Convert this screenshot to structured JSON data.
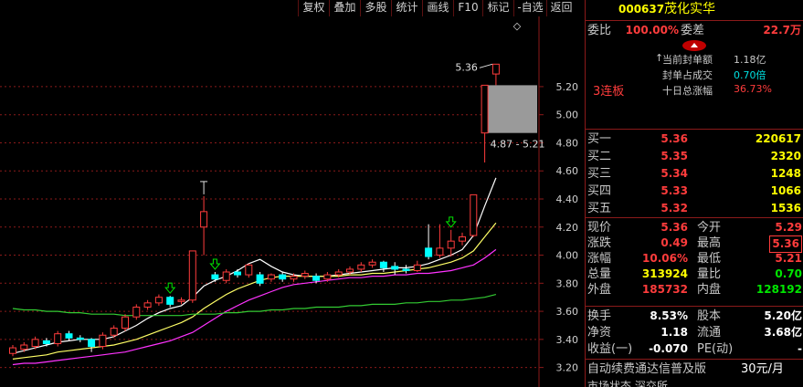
{
  "toolbar": {
    "buttons": [
      "复权",
      "叠加",
      "多股",
      "统计",
      "画线",
      "F10",
      "标记",
      "-自选",
      "返回"
    ]
  },
  "stock": {
    "code": "000637",
    "name": "茂化实华",
    "weibi_label": "委比",
    "weibi_value": "100.00%",
    "weicha_label": "委差",
    "weicha_value": "22.7万",
    "streak": "3连板",
    "seal_amount_label": "当前封单额",
    "seal_amount_value": "1.18亿",
    "seal_ratio_label": "封单占成交",
    "seal_ratio_value": "0.70倍",
    "tenday_label": "十日总涨幅",
    "tenday_value": "36.73%"
  },
  "bids": [
    {
      "label": "买一",
      "price": "5.36",
      "volume": "220617"
    },
    {
      "label": "买二",
      "price": "5.35",
      "volume": "2320"
    },
    {
      "label": "买三",
      "price": "5.34",
      "volume": "1248"
    },
    {
      "label": "买四",
      "price": "5.33",
      "volume": "1066"
    },
    {
      "label": "买五",
      "price": "5.32",
      "volume": "1536"
    }
  ],
  "quote": [
    {
      "l1": "现价",
      "v1": "5.36",
      "c1": "red",
      "l2": "今开",
      "v2": "5.29",
      "c2": "red",
      "box2": false
    },
    {
      "l1": "涨跌",
      "v1": "0.49",
      "c1": "red",
      "l2": "最高",
      "v2": "5.36",
      "c2": "red",
      "box2": true
    },
    {
      "l1": "涨幅",
      "v1": "10.06%",
      "c1": "red",
      "l2": "最低",
      "v2": "5.21",
      "c2": "red",
      "box2": false
    },
    {
      "l1": "总量",
      "v1": "313924",
      "c1": "yellow",
      "l2": "量比",
      "v2": "0.70",
      "c2": "green",
      "box2": false
    },
    {
      "l1": "外盘",
      "v1": "185732",
      "c1": "red",
      "l2": "内盘",
      "v2": "128192",
      "c2": "green",
      "box2": false
    }
  ],
  "fundamentals": [
    {
      "l1": "换手",
      "v1": "8.53%",
      "l2": "股本",
      "v2": "5.20亿"
    },
    {
      "l1": "净资",
      "v1": "1.18",
      "l2": "流通",
      "v2": "3.68亿"
    },
    {
      "l1": "收益(一)",
      "v1": "-0.070",
      "l2": "PE(动)",
      "v2": "-"
    }
  ],
  "footer": {
    "ad_text": "自动续费通达信普及版",
    "price_text": "30元/月",
    "cut_text": "市场状态 深交所 ..."
  },
  "chart_data": {
    "type": "candlestick",
    "y_axis": {
      "min": 3.1,
      "max": 5.7,
      "ticks": [
        "5.20",
        "5.00",
        "4.80",
        "4.60",
        "4.40",
        "4.20",
        "4.00",
        "3.80",
        "3.60",
        "3.40",
        "3.20"
      ]
    },
    "annotations": {
      "high_label": "5.36",
      "range_label": "4.87 - 5.21",
      "diamond_symbol": "◇"
    },
    "candles": [
      {
        "o": 3.3,
        "c": 3.34,
        "h": 3.36,
        "l": 3.28
      },
      {
        "o": 3.33,
        "c": 3.36,
        "h": 3.38,
        "l": 3.31
      },
      {
        "o": 3.35,
        "c": 3.4,
        "h": 3.42,
        "l": 3.33
      },
      {
        "o": 3.39,
        "c": 3.37,
        "h": 3.41,
        "l": 3.35
      },
      {
        "o": 3.37,
        "c": 3.44,
        "h": 3.46,
        "l": 3.35
      },
      {
        "o": 3.44,
        "c": 3.41,
        "h": 3.46,
        "l": 3.39
      },
      {
        "o": 3.41,
        "c": 3.4,
        "h": 3.43,
        "l": 3.38
      },
      {
        "o": 3.4,
        "c": 3.35,
        "h": 3.41,
        "l": 3.31
      },
      {
        "o": 3.35,
        "c": 3.43,
        "h": 3.45,
        "l": 3.33
      },
      {
        "o": 3.43,
        "c": 3.48,
        "h": 3.5,
        "l": 3.41
      },
      {
        "o": 3.48,
        "c": 3.56,
        "h": 3.58,
        "l": 3.46
      },
      {
        "o": 3.56,
        "c": 3.63,
        "h": 3.65,
        "l": 3.54
      },
      {
        "o": 3.63,
        "c": 3.66,
        "h": 3.68,
        "l": 3.61
      },
      {
        "o": 3.66,
        "c": 3.7,
        "h": 3.72,
        "l": 3.64
      },
      {
        "o": 3.7,
        "c": 3.65,
        "h": 3.71,
        "l": 3.63
      },
      {
        "o": 3.67,
        "c": 3.68,
        "h": 3.7,
        "l": 3.65
      },
      {
        "o": 3.68,
        "c": 4.03,
        "h": 4.03,
        "l": 3.66
      },
      {
        "o": 4.2,
        "c": 4.31,
        "h": 4.42,
        "l": 4.0
      },
      {
        "o": 3.86,
        "c": 3.83,
        "h": 3.88,
        "l": 3.81
      },
      {
        "o": 3.82,
        "c": 3.88,
        "h": 3.9,
        "l": 3.8
      },
      {
        "o": 3.88,
        "c": 3.86,
        "h": 3.9,
        "l": 3.84
      },
      {
        "o": 3.86,
        "c": 3.93,
        "h": 3.94,
        "l": 3.84
      },
      {
        "o": 3.86,
        "c": 3.8,
        "h": 3.88,
        "l": 3.78
      },
      {
        "o": 3.83,
        "c": 3.86,
        "h": 3.87,
        "l": 3.81
      },
      {
        "o": 3.86,
        "c": 3.83,
        "h": 3.88,
        "l": 3.81
      },
      {
        "o": 3.83,
        "c": 3.85,
        "h": 3.87,
        "l": 3.81
      },
      {
        "o": 3.85,
        "c": 3.87,
        "h": 3.89,
        "l": 3.83
      },
      {
        "o": 3.85,
        "c": 3.82,
        "h": 3.87,
        "l": 3.8
      },
      {
        "o": 3.83,
        "c": 3.86,
        "h": 3.88,
        "l": 3.81
      },
      {
        "o": 3.86,
        "c": 3.88,
        "h": 3.9,
        "l": 3.84
      },
      {
        "o": 3.88,
        "c": 3.9,
        "h": 3.92,
        "l": 3.86
      },
      {
        "o": 3.9,
        "c": 3.93,
        "h": 3.95,
        "l": 3.88
      },
      {
        "o": 3.93,
        "c": 3.95,
        "h": 3.97,
        "l": 3.91
      },
      {
        "o": 3.95,
        "c": 3.91,
        "h": 3.96,
        "l": 3.88
      },
      {
        "o": 3.92,
        "c": 3.9,
        "h": 3.95,
        "l": 3.86
      },
      {
        "o": 3.9,
        "c": 3.89,
        "h": 3.93,
        "l": 3.87
      },
      {
        "o": 3.89,
        "c": 3.93,
        "h": 3.96,
        "l": 3.88
      },
      {
        "o": 4.05,
        "c": 3.99,
        "h": 4.22,
        "l": 3.97
      },
      {
        "o": 4.0,
        "c": 4.05,
        "h": 4.22,
        "l": 3.98
      },
      {
        "o": 4.05,
        "c": 4.1,
        "h": 4.18,
        "l": 3.99
      },
      {
        "o": 4.1,
        "c": 4.13,
        "h": 4.16,
        "l": 4.07
      },
      {
        "o": 4.14,
        "c": 4.43,
        "h": 4.43,
        "l": 4.13
      },
      {
        "o": 4.87,
        "c": 5.21,
        "h": 5.21,
        "l": 4.66
      },
      {
        "o": 5.29,
        "c": 5.36,
        "h": 5.36,
        "l": 5.21
      }
    ],
    "gap_zone": {
      "low": 4.87,
      "high": 5.21
    },
    "arrow_candles": [
      14,
      18,
      39
    ],
    "ma_lines": [
      {
        "color": "#ffffff",
        "values": [
          3.3,
          3.32,
          3.34,
          3.36,
          3.38,
          3.39,
          3.4,
          3.4,
          3.4,
          3.42,
          3.46,
          3.5,
          3.55,
          3.59,
          3.62,
          3.64,
          3.7,
          3.78,
          3.82,
          3.85,
          3.89,
          3.94,
          3.97,
          3.92,
          3.88,
          3.86,
          3.85,
          3.85,
          3.85,
          3.86,
          3.87,
          3.88,
          3.89,
          3.9,
          3.91,
          3.91,
          3.92,
          3.94,
          3.97,
          4.0,
          4.04,
          4.14,
          4.35,
          4.55
        ]
      },
      {
        "color": "#ffff66",
        "values": [
          3.26,
          3.27,
          3.28,
          3.29,
          3.31,
          3.32,
          3.33,
          3.34,
          3.35,
          3.36,
          3.38,
          3.4,
          3.43,
          3.46,
          3.49,
          3.52,
          3.56,
          3.62,
          3.67,
          3.72,
          3.76,
          3.79,
          3.82,
          3.84,
          3.85,
          3.85,
          3.85,
          3.85,
          3.85,
          3.85,
          3.86,
          3.86,
          3.87,
          3.87,
          3.88,
          3.89,
          3.9,
          3.91,
          3.93,
          3.95,
          3.98,
          4.03,
          4.13,
          4.23
        ]
      },
      {
        "color": "#ff33ff",
        "values": [
          3.22,
          3.23,
          3.23,
          3.24,
          3.25,
          3.26,
          3.27,
          3.28,
          3.29,
          3.3,
          3.31,
          3.33,
          3.35,
          3.37,
          3.39,
          3.42,
          3.45,
          3.5,
          3.55,
          3.6,
          3.64,
          3.68,
          3.71,
          3.74,
          3.77,
          3.79,
          3.8,
          3.81,
          3.82,
          3.83,
          3.84,
          3.84,
          3.85,
          3.85,
          3.86,
          3.86,
          3.87,
          3.87,
          3.88,
          3.89,
          3.91,
          3.93,
          3.98,
          4.04
        ]
      },
      {
        "color": "#33cc33",
        "values": [
          3.62,
          3.61,
          3.61,
          3.6,
          3.6,
          3.59,
          3.59,
          3.58,
          3.58,
          3.58,
          3.57,
          3.57,
          3.57,
          3.57,
          3.57,
          3.57,
          3.58,
          3.58,
          3.58,
          3.59,
          3.59,
          3.6,
          3.6,
          3.61,
          3.61,
          3.62,
          3.62,
          3.63,
          3.63,
          3.63,
          3.64,
          3.64,
          3.65,
          3.65,
          3.65,
          3.66,
          3.66,
          3.67,
          3.67,
          3.68,
          3.68,
          3.69,
          3.7,
          3.72
        ]
      }
    ],
    "colors": {
      "up": "#ff3c3c",
      "down": "#00ffff",
      "gap_fill": "#9a9a9a",
      "arrow": "#00e600",
      "grid": "#8b1a1a"
    }
  }
}
